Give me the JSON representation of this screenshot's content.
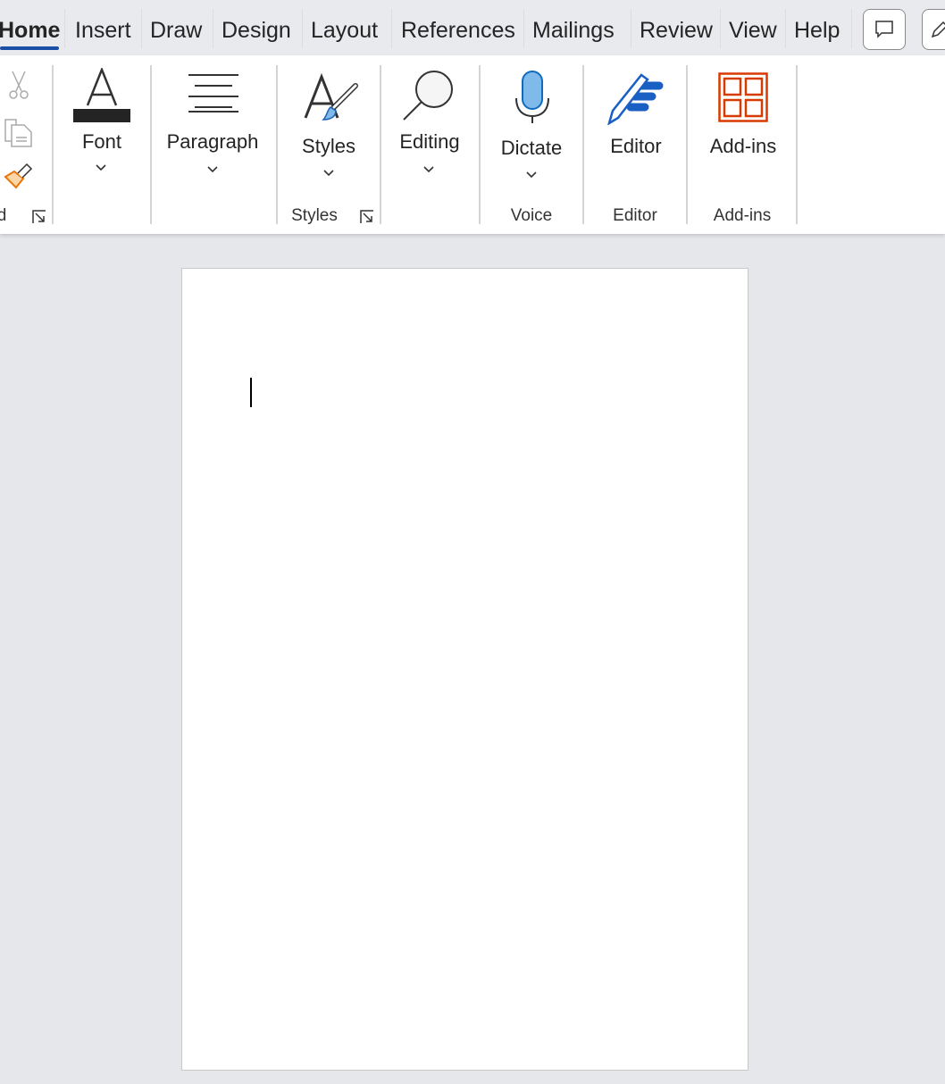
{
  "tabs": [
    {
      "label": "Home",
      "active": true
    },
    {
      "label": "Insert"
    },
    {
      "label": "Draw"
    },
    {
      "label": "Design"
    },
    {
      "label": "Layout"
    },
    {
      "label": "References"
    },
    {
      "label": "Mailings"
    },
    {
      "label": "Review"
    },
    {
      "label": "View"
    },
    {
      "label": "Help"
    }
  ],
  "toolbar_icons": [
    "comment-icon",
    "pen-icon"
  ],
  "ribbon": {
    "clipboard": {
      "label_fragment": "d",
      "icons": [
        "cut-icon",
        "copy-icon",
        "format-painter-icon"
      ]
    },
    "font": {
      "label": "Font"
    },
    "paragraph": {
      "label": "Paragraph"
    },
    "styles": {
      "label": "Styles",
      "group_label": "Styles"
    },
    "editing": {
      "label": "Editing"
    },
    "dictate": {
      "label": "Dictate",
      "group_label": "Voice"
    },
    "editor": {
      "label": "Editor",
      "group_label": "Editor"
    },
    "addins": {
      "label": "Add-ins",
      "group_label": "Add-ins"
    }
  },
  "colors": {
    "accent": "#1a4fa8",
    "addins": "#d83b01",
    "mic": "#7fbaea",
    "painter": "#e8760a"
  }
}
